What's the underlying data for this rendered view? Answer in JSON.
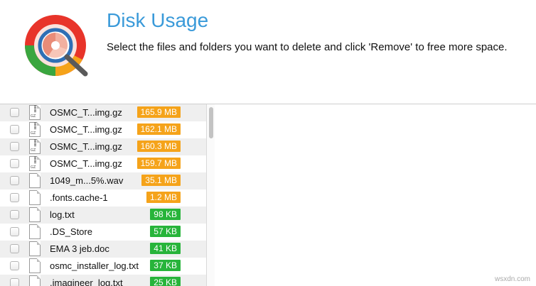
{
  "header": {
    "title": "Disk Usage",
    "subtitle": "Select the files and folders you want to delete and click 'Remove' to free more space."
  },
  "colors": {
    "accent": "#3a9ad9",
    "large_size": "#f5a31a",
    "small_size": "#27b43a"
  },
  "files": [
    {
      "name": "OSMC_T...img.gz",
      "size": "165.9 MB",
      "icon": "gz-archive-icon",
      "level": "orange"
    },
    {
      "name": "OSMC_T...img.gz",
      "size": "162.1 MB",
      "icon": "gz-archive-icon",
      "level": "orange"
    },
    {
      "name": "OSMC_T...img.gz",
      "size": "160.3 MB",
      "icon": "gz-archive-icon",
      "level": "orange"
    },
    {
      "name": "OSMC_T...img.gz",
      "size": "159.7 MB",
      "icon": "gz-archive-icon",
      "level": "orange"
    },
    {
      "name": "1049_m...5%.wav",
      "size": "35.1 MB",
      "icon": "document-icon",
      "level": "orange"
    },
    {
      "name": ".fonts.cache-1",
      "size": "1.2 MB",
      "icon": "document-icon",
      "level": "orange"
    },
    {
      "name": "log.txt",
      "size": "98 KB",
      "icon": "text-file-icon",
      "level": "green"
    },
    {
      "name": ".DS_Store",
      "size": "57 KB",
      "icon": "document-icon",
      "level": "green"
    },
    {
      "name": "EMA 3 jeb.doc",
      "size": "41 KB",
      "icon": "document-icon",
      "level": "green"
    },
    {
      "name": "osmc_installer_log.txt",
      "size": "37 KB",
      "icon": "text-file-icon",
      "level": "green"
    },
    {
      "name": ".imagineer_log.txt",
      "size": "25 KB",
      "icon": "text-file-icon",
      "level": "green"
    }
  ],
  "watermark": "wsxdn.com"
}
